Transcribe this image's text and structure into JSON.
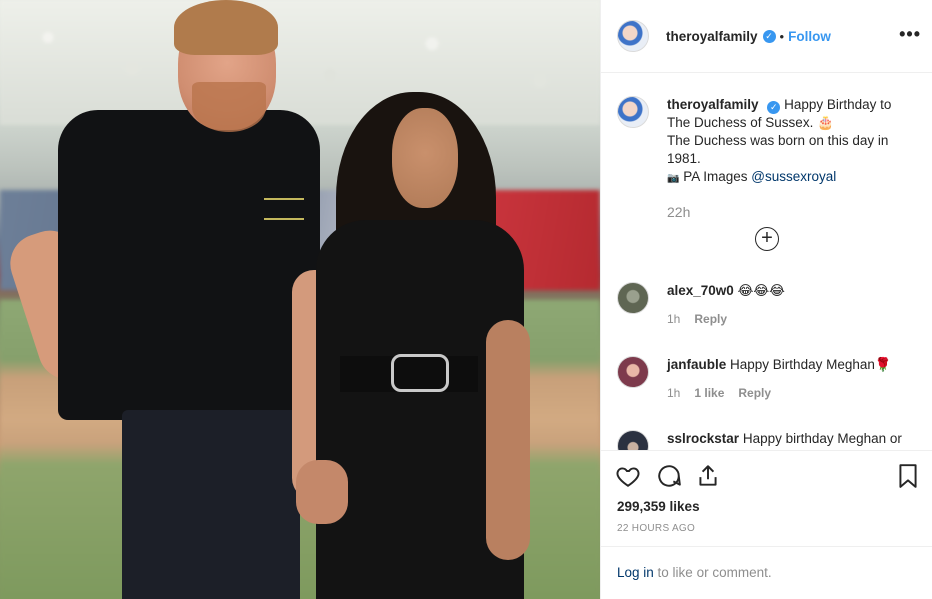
{
  "post": {
    "username": "theroyalfamily",
    "follow_label": "Follow",
    "more_label": "•••",
    "verified_glyph": "✓"
  },
  "caption": {
    "username": "theroyalfamily",
    "text1": "Happy Birthday to The Duchess of Sussex. 🎂",
    "text2": "The Duchess was born on this day in 1981.",
    "camera_glyph": "📷",
    "credit": "PA Images",
    "mention": "@sussexroyal",
    "time": "22h",
    "load_more_glyph": "+"
  },
  "comments": [
    {
      "user": "alex_70w0",
      "text": "😂😂😂",
      "time": "1h",
      "likes": "",
      "reply": "Reply"
    },
    {
      "user": "janfauble",
      "text": "Happy Birthday Meghan🌹",
      "time": "1h",
      "likes": "1 like",
      "reply": "Reply"
    },
    {
      "user": "sslrockstar",
      "text": "Happy birthday Meghan or"
    }
  ],
  "stats": {
    "likes": "299,359 likes",
    "ago": "22 HOURS AGO"
  },
  "footer": {
    "login": "Log in",
    "rest": " to like or comment."
  },
  "colors": {
    "accent": "#3897f0",
    "link": "#00376b",
    "muted": "#8e8e8e"
  }
}
